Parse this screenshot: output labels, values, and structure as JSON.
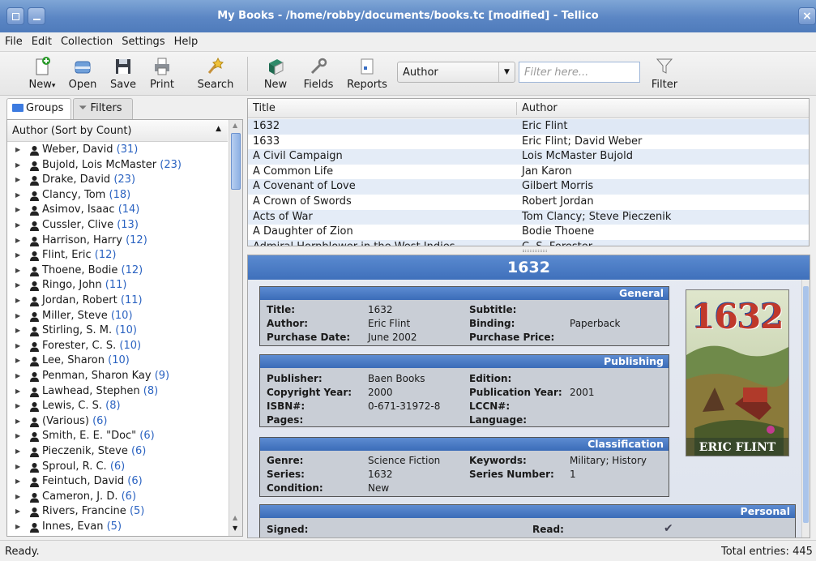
{
  "window": {
    "title": "My Books - /home/robby/documents/books.tc [modified] - Tellico",
    "close_glyph": "×"
  },
  "menu": [
    "File",
    "Edit",
    "Collection",
    "Settings",
    "Help"
  ],
  "toolbar": {
    "new": "New",
    "open": "Open",
    "save": "Save",
    "print": "Print",
    "search": "Search",
    "new2": "New",
    "fields": "Fields",
    "reports": "Reports",
    "filter_field": "Author",
    "filter_placeholder": "Filter here...",
    "filter": "Filter"
  },
  "tabs": {
    "groups": "Groups",
    "filters": "Filters"
  },
  "groups": {
    "header": "Author (Sort by Count)",
    "items": [
      {
        "name": "Weber, David",
        "count": "(31)"
      },
      {
        "name": "Bujold, Lois McMaster",
        "count": "(23)"
      },
      {
        "name": "Drake, David",
        "count": "(23)"
      },
      {
        "name": "Clancy, Tom",
        "count": "(18)"
      },
      {
        "name": "Asimov, Isaac",
        "count": "(14)"
      },
      {
        "name": "Cussler, Clive",
        "count": "(13)"
      },
      {
        "name": "Harrison, Harry",
        "count": "(12)"
      },
      {
        "name": "Flint, Eric",
        "count": "(12)"
      },
      {
        "name": "Thoene, Bodie",
        "count": "(12)"
      },
      {
        "name": "Ringo, John",
        "count": "(11)"
      },
      {
        "name": "Jordan, Robert",
        "count": "(11)"
      },
      {
        "name": "Miller, Steve",
        "count": "(10)"
      },
      {
        "name": "Stirling, S. M.",
        "count": "(10)"
      },
      {
        "name": "Forester, C. S.",
        "count": "(10)"
      },
      {
        "name": "Lee, Sharon",
        "count": "(10)"
      },
      {
        "name": "Penman, Sharon Kay",
        "count": "(9)"
      },
      {
        "name": "Lawhead, Stephen",
        "count": "(8)"
      },
      {
        "name": "Lewis, C. S.",
        "count": "(8)"
      },
      {
        "name": "(Various)",
        "count": "(6)"
      },
      {
        "name": "Smith, E. E. \"Doc\"",
        "count": "(6)"
      },
      {
        "name": "Pieczenik, Steve",
        "count": "(6)"
      },
      {
        "name": "Sproul, R. C.",
        "count": "(6)"
      },
      {
        "name": "Feintuch, David",
        "count": "(6)"
      },
      {
        "name": "Cameron, J. D.",
        "count": "(6)"
      },
      {
        "name": "Rivers, Francine",
        "count": "(5)"
      },
      {
        "name": "Innes, Evan",
        "count": "(5)"
      }
    ]
  },
  "list": {
    "columns": [
      "Title",
      "Author"
    ],
    "rows": [
      [
        "1632",
        "Eric Flint"
      ],
      [
        "1633",
        "Eric Flint; David Weber"
      ],
      [
        "A Civil Campaign",
        "Lois McMaster Bujold"
      ],
      [
        "A Common Life",
        "Jan Karon"
      ],
      [
        "A Covenant of Love",
        "Gilbert Morris"
      ],
      [
        "A Crown of Swords",
        "Robert Jordan"
      ],
      [
        "Acts of War",
        "Tom Clancy; Steve Pieczenik"
      ],
      [
        "A Daughter of Zion",
        "Bodie Thoene"
      ],
      [
        "Admiral Hornblower in the West Indies",
        "C. S. Forester"
      ]
    ]
  },
  "detail": {
    "title": "1632",
    "general": {
      "header": "General",
      "title_l": "Title:",
      "title_v": "1632",
      "author_l": "Author:",
      "author_v": "Eric Flint",
      "pdate_l": "Purchase Date:",
      "pdate_v": "June 2002",
      "subtitle_l": "Subtitle:",
      "binding_l": "Binding:",
      "binding_v": "Paperback",
      "pprice_l": "Purchase Price:"
    },
    "publishing": {
      "header": "Publishing",
      "pub_l": "Publisher:",
      "pub_v": "Baen Books",
      "cy_l": "Copyright Year:",
      "cy_v": "2000",
      "isbn_l": "ISBN#:",
      "isbn_v": "0-671-31972-8",
      "pages_l": "Pages:",
      "ed_l": "Edition:",
      "py_l": "Publication Year:",
      "py_v": "2001",
      "lccn_l": "LCCN#:",
      "lang_l": "Language:"
    },
    "classification": {
      "header": "Classification",
      "genre_l": "Genre:",
      "genre_v": "Science Fiction",
      "series_l": "Series:",
      "series_v": "1632",
      "cond_l": "Condition:",
      "cond_v": "New",
      "kw_l": "Keywords:",
      "kw_v": "Military; History",
      "sn_l": "Series Number:",
      "sn_v": "1"
    },
    "personal": {
      "header": "Personal",
      "signed_l": "Signed:",
      "read_l": "Read:",
      "read_v": "✔"
    },
    "cover": {
      "title": "1632",
      "author": "ERIC FLINT"
    }
  },
  "status": {
    "left": "Ready.",
    "right": "Total entries: 445"
  },
  "colors": {
    "accent": "#4a78c0",
    "count": "#2b63c1",
    "alt_row": "#e4ecf7"
  }
}
